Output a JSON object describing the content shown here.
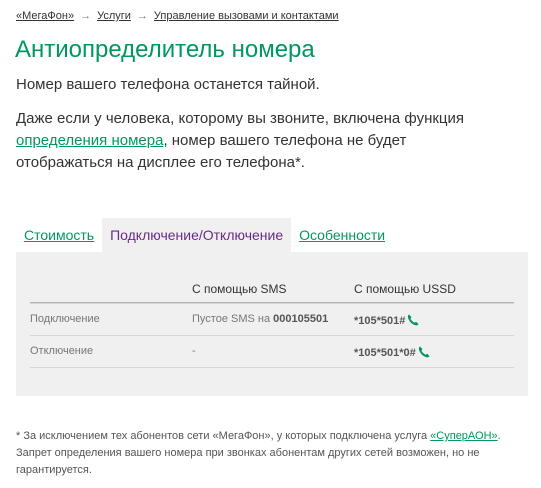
{
  "breadcrumb": {
    "items": [
      "«МегаФон»",
      "Услуги",
      "Управление вызовами и контактами"
    ],
    "separator": "→"
  },
  "page": {
    "title": "Антиопределитель номера",
    "subtitle": "Номер вашего телефона останется тайной.",
    "lead": {
      "before_link": "Даже если у человека, которому вы звоните, включена функция ",
      "link": "определения номера",
      "after_link": ", номер вашего телефона не будет отображаться на дисплее его телефона*."
    }
  },
  "tabs": [
    {
      "label": "Стоимость",
      "active": false
    },
    {
      "label": "Подключение/Отключение",
      "active": true
    },
    {
      "label": "Особенности",
      "active": false
    }
  ],
  "table": {
    "headers": [
      "",
      "С помощью SMS",
      "С помощью USSD"
    ],
    "rows": [
      {
        "action": "Подключение",
        "sms_prefix": "Пустое SMS на ",
        "sms_number": "000105501",
        "ussd": "*105*501#"
      },
      {
        "action": "Отключение",
        "sms_prefix": "-",
        "sms_number": "",
        "ussd": "*105*501*0#"
      }
    ]
  },
  "footnote": {
    "before_link": "* За исключением тех абонентов сети «МегаФон», у которых подключена услуга ",
    "link": "«СуперАОН»",
    "after_link": ". Запрет определения вашего номера при звонках абонентам других сетей возможен, но не гарантируется."
  },
  "colors": {
    "brand_green": "#00985f",
    "active_tab_text": "#6a2b85",
    "panel_bg": "#f0f0f0"
  },
  "icons": {
    "ussd_call": "phone-handset-icon"
  }
}
